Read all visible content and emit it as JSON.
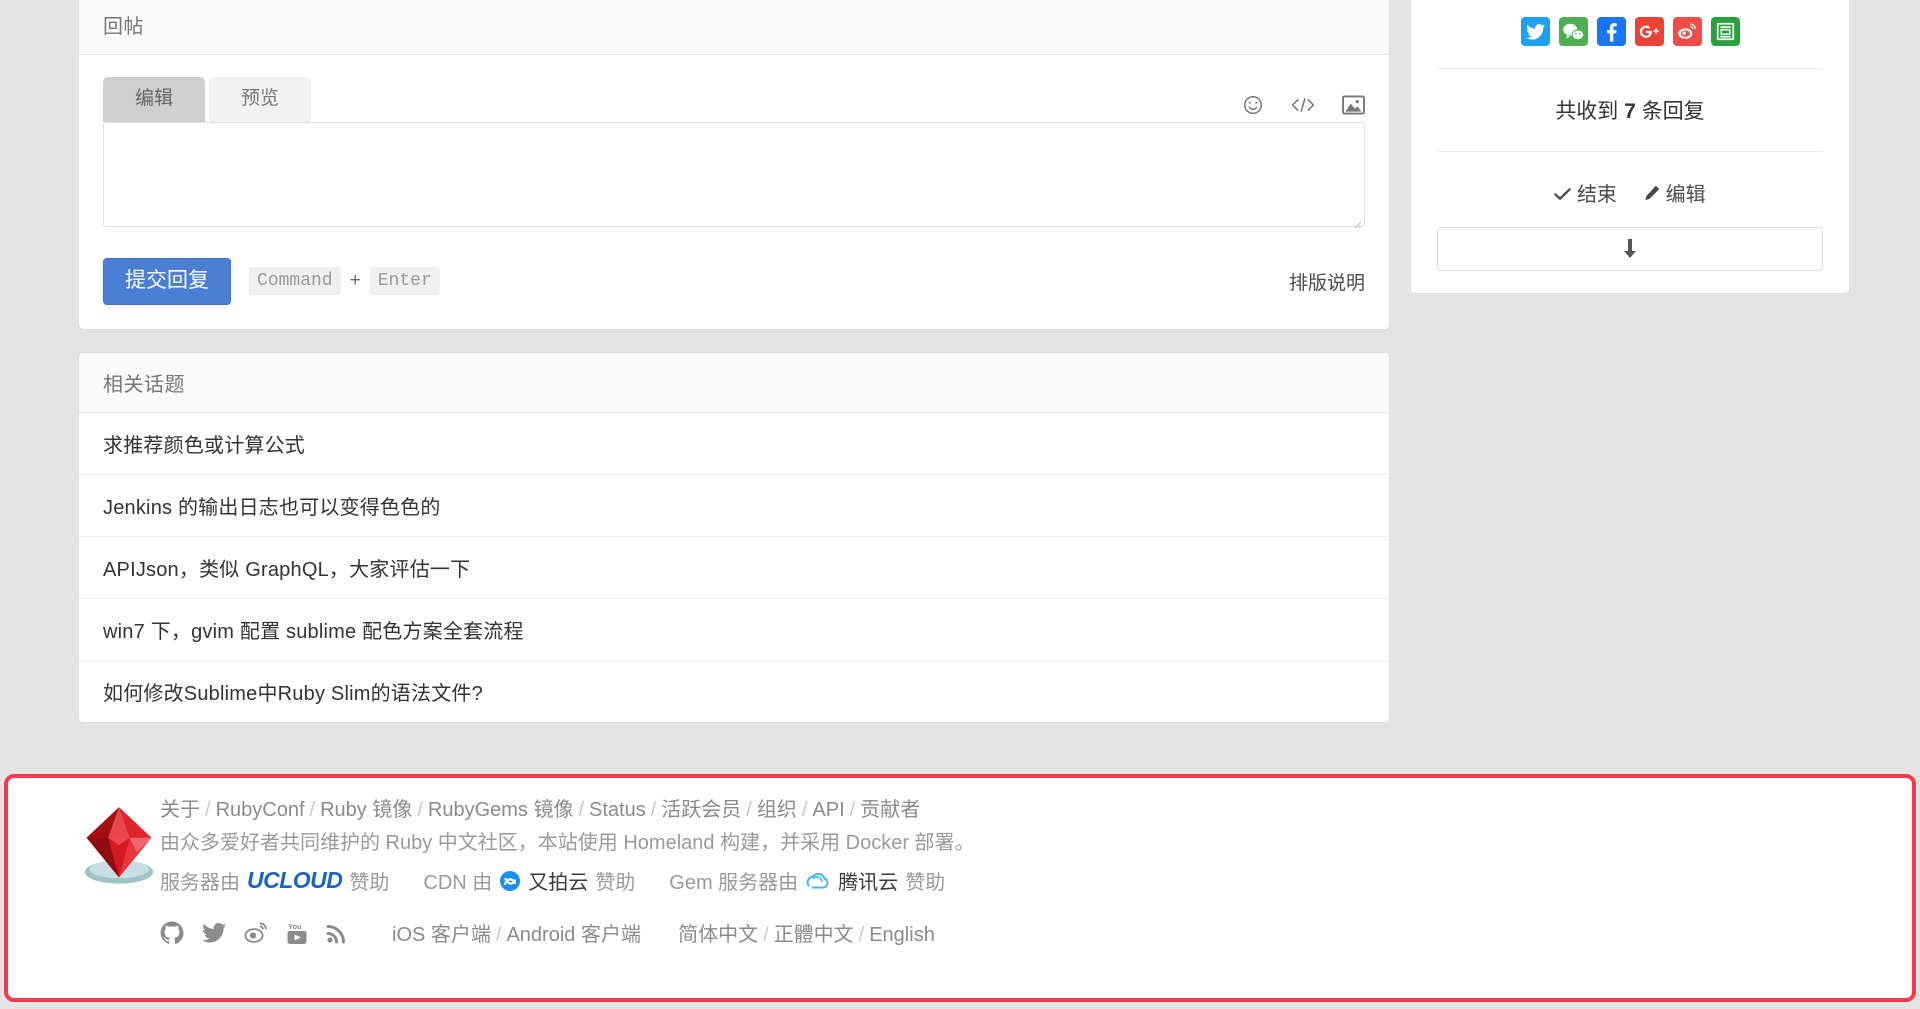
{
  "reply_panel": {
    "title": "回帖",
    "tabs": [
      {
        "label": "编辑",
        "active": true
      },
      {
        "label": "预览",
        "active": false
      }
    ],
    "toolbar_icons": [
      "emoji-icon",
      "code-icon",
      "image-icon"
    ],
    "textarea_value": "",
    "textarea_placeholder": "",
    "submit_label": "提交回复",
    "shortcut_key1": "Command",
    "shortcut_plus": "+",
    "shortcut_key2": "Enter",
    "typeset_link": "排版说明"
  },
  "related": {
    "title": "相关话题",
    "items": [
      "求推荐颜色或计算公式",
      "Jenkins 的输出日志也可以变得色色的",
      "APIJson，类似 GraphQL，大家评估一下",
      "win7 下，gvim 配置 sublime 配色方案全套流程",
      "如何修改Sublime中Ruby Slim的语法文件?"
    ]
  },
  "sidebar": {
    "share_icons": [
      {
        "name": "twitter-icon",
        "color": "#1da1f2"
      },
      {
        "name": "wechat-icon",
        "color": "#4caf50"
      },
      {
        "name": "facebook-icon",
        "color": "#1877f2"
      },
      {
        "name": "googleplus-icon",
        "color": "#ea4335"
      },
      {
        "name": "weibo-icon",
        "color": "#ef4b4b"
      },
      {
        "name": "douban-icon",
        "color": "#2aa13c"
      }
    ],
    "reply_count_prefix": "共收到",
    "reply_count_number": "7",
    "reply_count_suffix": "条回复",
    "op_close": "结束",
    "op_edit": "编辑",
    "scroll_button_icon": "arrow-down-icon"
  },
  "footer": {
    "logo": "ruby-gem-logo",
    "nav_links": [
      "关于",
      "RubyConf",
      "Ruby 镜像",
      "RubyGems 镜像",
      "Status",
      "活跃会员",
      "组织",
      "API",
      "贡献者"
    ],
    "description": "由众多爱好者共同维护的 Ruby 中文社区，本站使用 Homeland 构建，并采用 Docker 部署。",
    "sponsors": [
      {
        "prefix": "服务器由",
        "brand": "UCLOUD",
        "suffix": "赞助"
      },
      {
        "prefix": "CDN 由",
        "brand": "又拍云",
        "suffix": "赞助"
      },
      {
        "prefix": "Gem 服务器由",
        "brand": "腾讯云",
        "suffix": "赞助"
      }
    ],
    "social_icons": [
      "github-icon",
      "twitter-icon",
      "weibo-icon",
      "youtube-icon",
      "rss-icon"
    ],
    "client_links": [
      "iOS 客户端",
      "Android 客户端"
    ],
    "language_links": [
      "简体中文",
      "正體中文",
      "English"
    ],
    "highlight_color": "#f93a4e"
  },
  "theme": {
    "page_background": "#e4e4e4",
    "panel_background": "#ffffff",
    "primary_button": "#4a7fd4"
  }
}
